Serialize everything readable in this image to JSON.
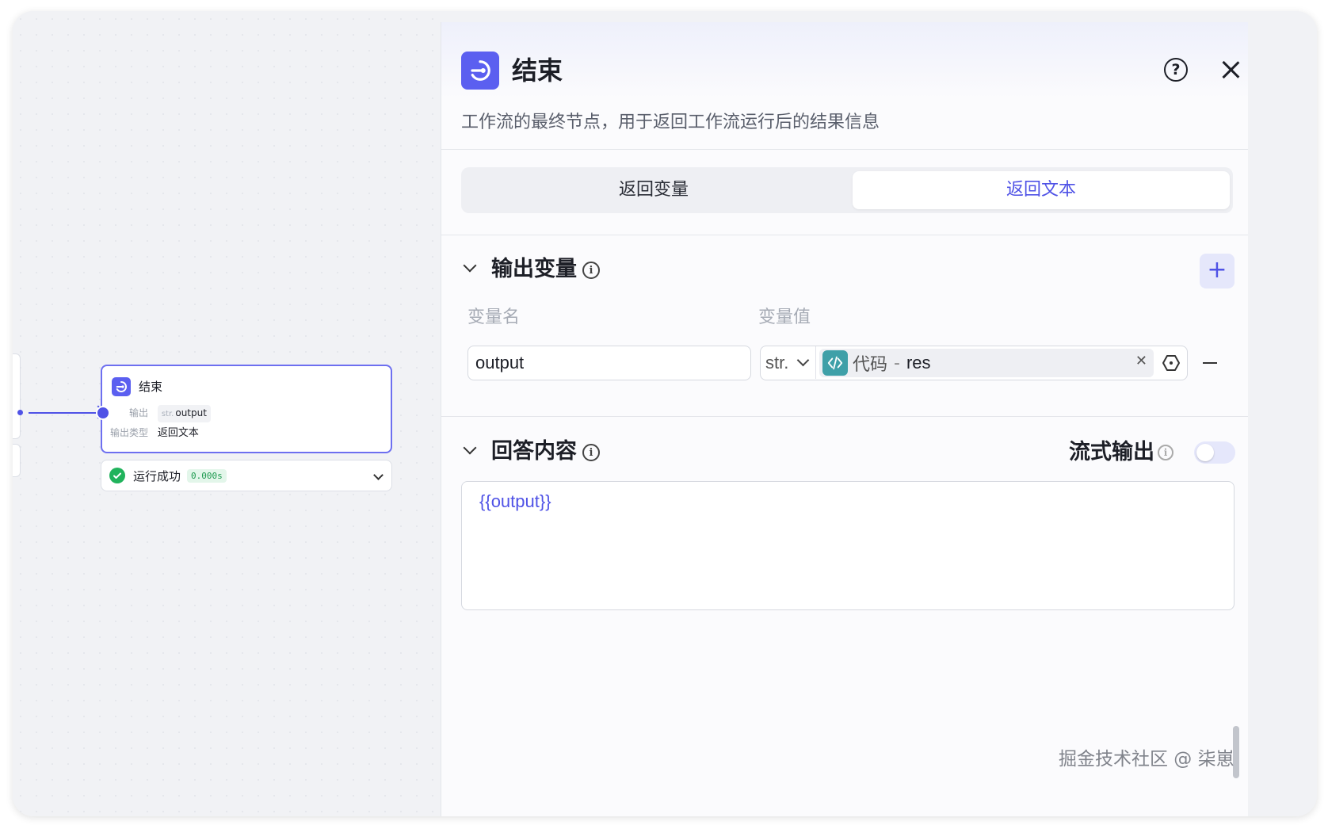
{
  "panel": {
    "title": "结束",
    "description": "工作流的最终节点，用于返回工作流运行后的结果信息",
    "help_icon": "question-circle-icon",
    "close_icon": "close-icon",
    "tabs": [
      {
        "label": "返回变量",
        "active": false
      },
      {
        "label": "返回文本",
        "active": true
      }
    ],
    "output_section": {
      "title": "输出变量",
      "add_icon": "plus-icon",
      "col_name_label": "变量名",
      "col_value_label": "变量值",
      "rows": [
        {
          "name": "output",
          "type": "str.",
          "ref_source": "代码",
          "ref_separator": "-",
          "ref_var": "res",
          "clear_icon": "close-small-icon",
          "pick_icon": "variable-picker-icon"
        }
      ]
    },
    "answer_section": {
      "title": "回答内容",
      "stream_label": "流式输出",
      "stream_enabled": false,
      "content": "{{output}}"
    }
  },
  "canvas": {
    "node": {
      "title": "结束",
      "output_label": "输出",
      "output_type": "str.",
      "output_value": "output",
      "output_kind_label": "输出类型",
      "output_kind_value": "返回文本"
    },
    "run_status": {
      "text": "运行成功",
      "time": "0.000s"
    }
  },
  "watermark": "掘金技术社区 @ 柒崽",
  "colors": {
    "accent": "#4f52e6",
    "node_icon": "#5b5ff0",
    "success": "#21b35c",
    "code_icon": "#3fa0a8"
  }
}
